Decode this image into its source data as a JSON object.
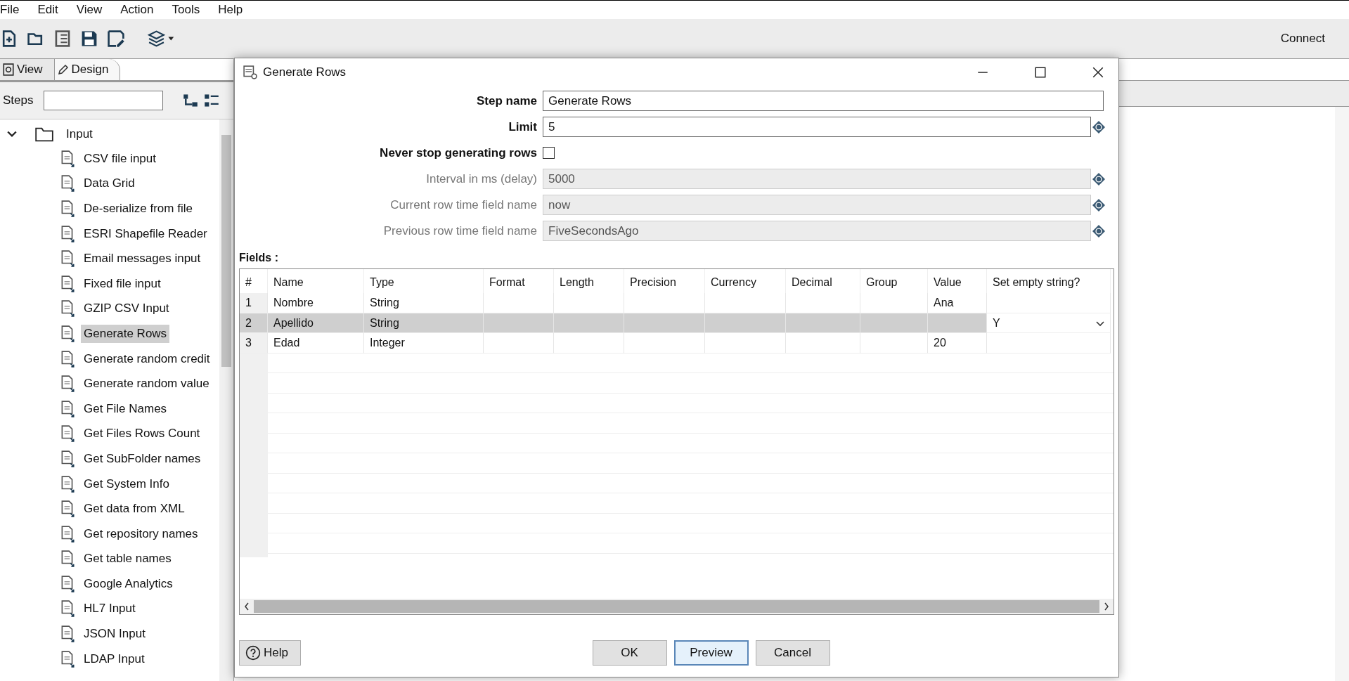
{
  "menu": [
    "File",
    "Edit",
    "View",
    "Action",
    "Tools",
    "Help"
  ],
  "connect": "Connect",
  "left_tabs": [
    {
      "label": "View",
      "selected": false
    },
    {
      "label": "Design",
      "selected": true
    }
  ],
  "steps_label": "Steps",
  "tree": {
    "label": "Input",
    "expanded": true,
    "children": [
      {
        "label": "CSV file input",
        "selected": false
      },
      {
        "label": "Data Grid",
        "selected": false
      },
      {
        "label": "De-serialize from file",
        "selected": false
      },
      {
        "label": "ESRI Shapefile Reader",
        "selected": false
      },
      {
        "label": "Email messages input",
        "selected": false
      },
      {
        "label": "Fixed file input",
        "selected": false
      },
      {
        "label": "GZIP CSV Input",
        "selected": false
      },
      {
        "label": "Generate Rows",
        "selected": true
      },
      {
        "label": "Generate random credit",
        "selected": false
      },
      {
        "label": "Generate random value",
        "selected": false
      },
      {
        "label": "Get File Names",
        "selected": false
      },
      {
        "label": "Get Files Rows Count",
        "selected": false
      },
      {
        "label": "Get SubFolder names",
        "selected": false
      },
      {
        "label": "Get System Info",
        "selected": false
      },
      {
        "label": "Get data from XML",
        "selected": false
      },
      {
        "label": "Get repository names",
        "selected": false
      },
      {
        "label": "Get table names",
        "selected": false
      },
      {
        "label": "Google Analytics",
        "selected": false
      },
      {
        "label": "HL7 Input",
        "selected": false
      },
      {
        "label": "JSON Input",
        "selected": false
      },
      {
        "label": "LDAP Input",
        "selected": false
      }
    ]
  },
  "dialog": {
    "title": "Generate Rows",
    "form": [
      {
        "kind": "text",
        "label": "Step name",
        "value": "Generate Rows",
        "disabled": false,
        "variable": false
      },
      {
        "kind": "text",
        "label": "Limit",
        "value": "5",
        "disabled": false,
        "variable": true
      },
      {
        "kind": "checkbox",
        "label": "Never stop generating rows",
        "checked": false,
        "disabled": false
      },
      {
        "kind": "text",
        "label": "Interval in ms (delay)",
        "value": "5000",
        "disabled": true,
        "variable": true
      },
      {
        "kind": "text",
        "label": "Current row time field name",
        "value": "now",
        "disabled": true,
        "variable": true
      },
      {
        "kind": "text",
        "label": "Previous row time field name",
        "value": "FiveSecondsAgo",
        "disabled": true,
        "variable": true
      }
    ],
    "fields_label": "Fields :",
    "table": {
      "columns": [
        "#",
        "Name",
        "Type",
        "Format",
        "Length",
        "Precision",
        "Currency",
        "Decimal",
        "Group",
        "Value",
        "Set empty string?"
      ],
      "rows": [
        {
          "cells": [
            "1",
            "Nombre",
            "String",
            "",
            "",
            "",
            "",
            "",
            "",
            "Ana",
            ""
          ],
          "selected": false
        },
        {
          "cells": [
            "2",
            "Apellido",
            "String",
            "",
            "",
            "",
            "",
            "",
            "",
            "",
            "Y"
          ],
          "selected": true
        },
        {
          "cells": [
            "3",
            "Edad",
            "Integer",
            "",
            "",
            "",
            "",
            "",
            "",
            "20",
            ""
          ],
          "selected": false
        }
      ]
    },
    "buttons": [
      {
        "label": "OK",
        "focused": false
      },
      {
        "label": "Preview",
        "focused": true
      },
      {
        "label": "Cancel",
        "focused": false
      }
    ],
    "help": "Help"
  }
}
